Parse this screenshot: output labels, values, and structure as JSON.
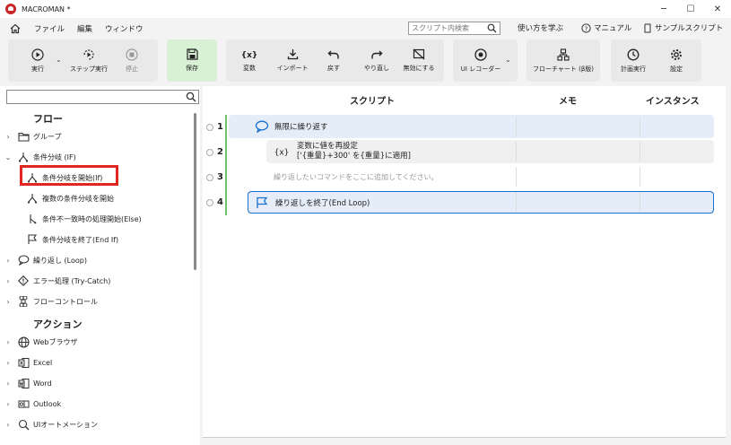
{
  "window": {
    "title": "MACROMAN *",
    "controls": [
      "─",
      "☐",
      "✕"
    ]
  },
  "menu": {
    "items": [
      "ファイル",
      "編集",
      "ウィンドウ"
    ],
    "search_placeholder": "スクリプト内検索",
    "links": [
      "使い方を学ぶ",
      "マニュアル",
      "サンプルスクリプト"
    ]
  },
  "ribbon": {
    "run": "実行",
    "step_run": "ステップ実行",
    "stop": "停止",
    "save": "保存",
    "variable": "変数",
    "import": "インポート",
    "undo": "戻す",
    "redo": "やり直し",
    "disable": "無効にする",
    "ui_recorder": "UI レコーダー",
    "flowchart": "フローチャート (β版)",
    "scheduled_run": "計画実行",
    "settings": "設定"
  },
  "sidebar": {
    "search_value": "",
    "flow_header": "フロー",
    "action_header": "アクション",
    "flow_items": [
      {
        "label": "グループ",
        "icon": "folder-icon",
        "chev": "›"
      },
      {
        "label": "条件分岐 (IF)",
        "icon": "branch-icon",
        "chev": "⌄"
      },
      {
        "label": "条件分岐を開始(If)",
        "icon": "branch-icon"
      },
      {
        "label": "複数の条件分岐を開始",
        "icon": "branch-icon"
      },
      {
        "label": "条件不一致時の処理開始(Else)",
        "icon": "else-icon"
      },
      {
        "label": "条件分岐を終了(End If)",
        "icon": "flag-icon"
      },
      {
        "label": "繰り返し (Loop)",
        "icon": "loop-icon",
        "chev": "›"
      },
      {
        "label": "エラー処理 (Try-Catch)",
        "icon": "error-icon",
        "chev": "›"
      },
      {
        "label": "フローコントロール",
        "icon": "command-icon",
        "chev": "›"
      }
    ],
    "action_items": [
      {
        "label": "Webブラウザ",
        "icon": "globe-icon"
      },
      {
        "label": "Excel",
        "icon": "excel-icon"
      },
      {
        "label": "Word",
        "icon": "word-icon"
      },
      {
        "label": "Outlook",
        "icon": "mail-icon"
      },
      {
        "label": "UIオートメーション",
        "icon": "automation-icon"
      }
    ]
  },
  "script": {
    "columns": [
      "スクリプト",
      "メモ",
      "インスタンス"
    ],
    "rows": [
      {
        "num": "1",
        "label": "無限に繰り返す"
      },
      {
        "num": "2",
        "label": "変数に値を再設定",
        "sub": "['{重量}+300' を{重量}に適用]"
      },
      {
        "num": "3",
        "label": "繰り返したいコマンドをここに追加してください。"
      },
      {
        "num": "4",
        "label": "繰り返しを終了(End Loop)"
      }
    ]
  },
  "colors": {
    "accent": "#1a6fd0",
    "highlight": "#e0261f",
    "green_bar": "#6cc36c",
    "save_bg": "#d8f0d4"
  }
}
